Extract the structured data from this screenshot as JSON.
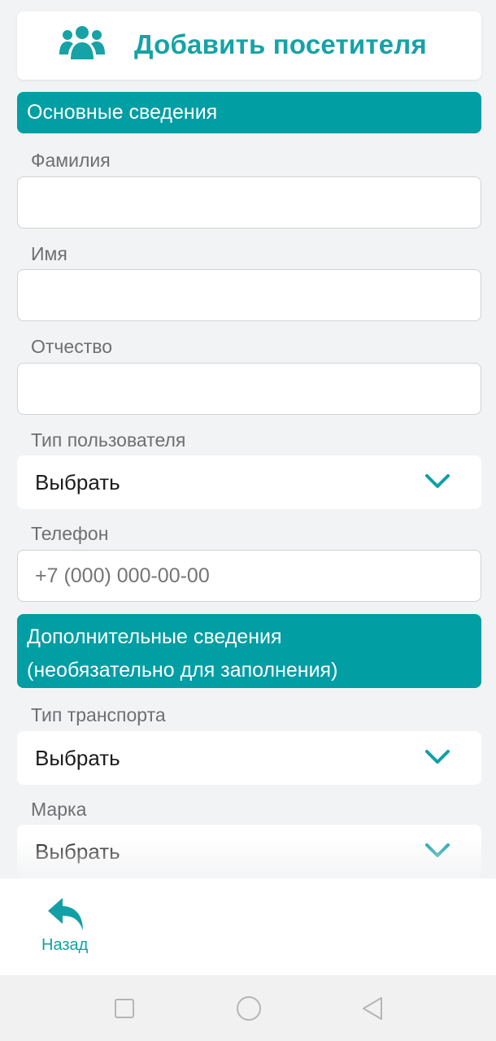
{
  "header": {
    "title": "Добавить посетителя",
    "icon": "users-icon"
  },
  "sections": {
    "main": "Основные сведения",
    "extra_line1": "Дополнительные сведения",
    "extra_line2": "(необязательно для заполнения)"
  },
  "form": {
    "lastname": {
      "label": "Фамилия",
      "value": ""
    },
    "firstname": {
      "label": "Имя",
      "value": ""
    },
    "middlename": {
      "label": "Отчество",
      "value": ""
    },
    "user_type": {
      "label": "Тип пользователя",
      "value": "Выбрать"
    },
    "phone": {
      "label": "Телефон",
      "placeholder": "+7 (000) 000-00-00"
    },
    "transport_type": {
      "label": "Тип транспорта",
      "value": "Выбрать"
    },
    "brand": {
      "label": "Марка",
      "value": "Выбрать"
    }
  },
  "bottombar": {
    "back_label": "Назад"
  },
  "colors": {
    "accent": "#019ea4",
    "title": "#17a2a6",
    "background": "#f2f3f4"
  }
}
